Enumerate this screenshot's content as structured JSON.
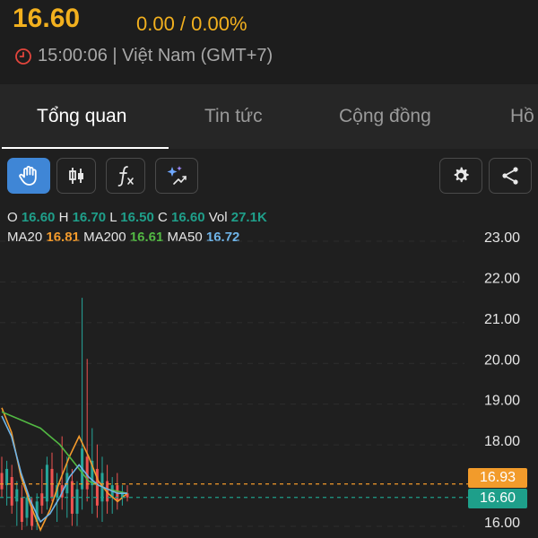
{
  "header": {
    "price": "16.60",
    "change": "0.00 / 0.00%",
    "time": "15:00:06 | Việt Nam (GMT+7)",
    "accent_color": "#f2b01e"
  },
  "tabs": [
    {
      "label": "Tổng quan",
      "active": true
    },
    {
      "label": "Tin tức",
      "active": false
    },
    {
      "label": "Cộng đồng",
      "active": false
    },
    {
      "label": "Hồ",
      "active": false
    }
  ],
  "toolbar": {
    "left": [
      "hand-icon",
      "candlestick-icon",
      "function-icon",
      "ai-sparkle-icon"
    ],
    "right": [
      "gear-icon",
      "share-icon"
    ]
  },
  "ohlc": {
    "o_label": "O",
    "o": "16.60",
    "h_label": "H",
    "h": "16.70",
    "l_label": "L",
    "l": "16.50",
    "c_label": "C",
    "c": "16.60",
    "vol_label": "Vol",
    "vol": "27.1K"
  },
  "ma": {
    "ma20_label": "MA20",
    "ma20": "16.81",
    "ma200_label": "MA200",
    "ma200": "16.61",
    "ma50_label": "MA50",
    "ma50": "16.72"
  },
  "chart_data": {
    "type": "line",
    "y_ticks": [
      "23.00",
      "22.00",
      "21.00",
      "20.00",
      "19.00",
      "18.00",
      "16.00"
    ],
    "ylim": [
      16.0,
      23.0
    ],
    "price_tags": [
      {
        "value": "16.93",
        "color": "#f29b2b"
      },
      {
        "value": "16.60",
        "color": "#1e9f8a"
      }
    ],
    "series": [
      {
        "name": "MA20",
        "color": "#f39a2c",
        "values": [
          18.8,
          18.2,
          17.1,
          16.4,
          15.8,
          16.3,
          17.0,
          17.6,
          18.1,
          17.6,
          17.0,
          16.7,
          16.5,
          16.7
        ]
      },
      {
        "name": "MA200",
        "color": "#52b843",
        "values": [
          18.7,
          18.6,
          18.5,
          18.4,
          18.3,
          18.1,
          17.9,
          17.6,
          17.3,
          17.0,
          16.9,
          16.8,
          16.75,
          16.7
        ]
      },
      {
        "name": "MA50",
        "color": "#6fb4e8",
        "values": [
          18.6,
          18.1,
          17.2,
          16.5,
          16.0,
          16.2,
          16.6,
          17.1,
          17.4,
          17.1,
          16.9,
          16.8,
          16.7,
          16.7
        ]
      }
    ],
    "candles": [
      {
        "o": 17.2,
        "h": 17.6,
        "l": 16.6,
        "c": 16.8
      },
      {
        "o": 16.9,
        "h": 17.5,
        "l": 16.4,
        "c": 17.3
      },
      {
        "o": 17.1,
        "h": 17.4,
        "l": 16.2,
        "c": 16.4
      },
      {
        "o": 16.5,
        "h": 17.0,
        "l": 15.9,
        "c": 16.8
      },
      {
        "o": 16.6,
        "h": 16.9,
        "l": 15.8,
        "c": 16.0
      },
      {
        "o": 16.1,
        "h": 16.8,
        "l": 15.9,
        "c": 16.6
      },
      {
        "o": 16.4,
        "h": 16.6,
        "l": 15.8,
        "c": 15.9
      },
      {
        "o": 16.0,
        "h": 16.7,
        "l": 15.8,
        "c": 16.5
      },
      {
        "o": 16.7,
        "h": 17.3,
        "l": 16.2,
        "c": 16.4
      },
      {
        "o": 16.5,
        "h": 17.6,
        "l": 16.3,
        "c": 17.4
      },
      {
        "o": 17.3,
        "h": 17.7,
        "l": 16.5,
        "c": 16.6
      },
      {
        "o": 16.6,
        "h": 17.2,
        "l": 16.0,
        "c": 16.9
      },
      {
        "o": 16.9,
        "h": 18.1,
        "l": 16.3,
        "c": 16.6
      },
      {
        "o": 16.7,
        "h": 17.6,
        "l": 16.1,
        "c": 17.2
      },
      {
        "o": 17.0,
        "h": 17.3,
        "l": 15.9,
        "c": 16.2
      },
      {
        "o": 16.2,
        "h": 17.0,
        "l": 15.9,
        "c": 16.8
      },
      {
        "o": 16.8,
        "h": 21.5,
        "l": 16.3,
        "c": 17.8
      },
      {
        "o": 17.6,
        "h": 20.0,
        "l": 16.5,
        "c": 16.8
      },
      {
        "o": 16.9,
        "h": 18.3,
        "l": 16.2,
        "c": 17.5
      },
      {
        "o": 17.3,
        "h": 17.9,
        "l": 16.1,
        "c": 16.4
      },
      {
        "o": 16.5,
        "h": 17.6,
        "l": 16.0,
        "c": 17.2
      },
      {
        "o": 17.0,
        "h": 17.4,
        "l": 16.2,
        "c": 16.5
      },
      {
        "o": 16.6,
        "h": 17.1,
        "l": 16.2,
        "c": 16.9
      },
      {
        "o": 16.9,
        "h": 17.2,
        "l": 16.3,
        "c": 16.5
      },
      {
        "o": 16.6,
        "h": 16.9,
        "l": 16.4,
        "c": 16.7
      },
      {
        "o": 16.7,
        "h": 16.9,
        "l": 16.5,
        "c": 16.6
      }
    ]
  }
}
